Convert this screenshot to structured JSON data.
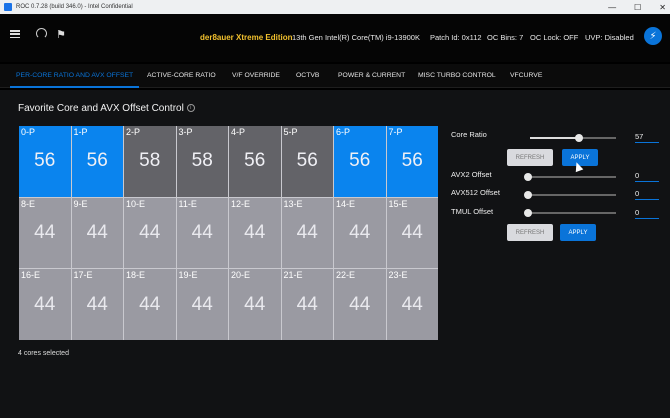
{
  "window": {
    "title": "ROC 0.7.28 (build 346.0) - Intel Confidential",
    "controls": [
      "—",
      "☐",
      "✕"
    ]
  },
  "header": {
    "edition": "der8auer Xtreme Edition",
    "cpu": "13th Gen Intel(R) Core(TM) i9-13900K",
    "patch": "Patch Id: 0x112",
    "oc_bins": "OC Bins: 7",
    "oc_lock": "OC Lock: OFF",
    "uvp": "UVP: Disabled",
    "power_icon": "⚡",
    "flag_icon": "⚑"
  },
  "tabs": [
    {
      "label": "PER-CORE RATIO AND AVX OFFSET",
      "active": true
    },
    {
      "label": "ACTIVE-CORE RATIO"
    },
    {
      "label": "V/F OVERRIDE"
    },
    {
      "label": "OCTVB"
    },
    {
      "label": "POWER & CURRENT"
    },
    {
      "label": "MISC TURBO CONTROL"
    },
    {
      "label": "VFCURVE"
    }
  ],
  "section": {
    "title": "Favorite Core and AVX Offset Control",
    "info_icon": "i"
  },
  "cores": [
    {
      "name": "0-P",
      "value": "56",
      "state": "selected"
    },
    {
      "name": "1-P",
      "value": "56",
      "state": "selected"
    },
    {
      "name": "2-P",
      "value": "58",
      "state": "p-dark"
    },
    {
      "name": "3-P",
      "value": "58",
      "state": "p-dark"
    },
    {
      "name": "4-P",
      "value": "56",
      "state": "p-dark"
    },
    {
      "name": "5-P",
      "value": "56",
      "state": "p-dark"
    },
    {
      "name": "6-P",
      "value": "56",
      "state": "selected"
    },
    {
      "name": "7-P",
      "value": "56",
      "state": "selected"
    },
    {
      "name": "8-E",
      "value": "44",
      "state": "e"
    },
    {
      "name": "9-E",
      "value": "44",
      "state": "e"
    },
    {
      "name": "10-E",
      "value": "44",
      "state": "e"
    },
    {
      "name": "11-E",
      "value": "44",
      "state": "e"
    },
    {
      "name": "12-E",
      "value": "44",
      "state": "e"
    },
    {
      "name": "13-E",
      "value": "44",
      "state": "e"
    },
    {
      "name": "14-E",
      "value": "44",
      "state": "e"
    },
    {
      "name": "15-E",
      "value": "44",
      "state": "e"
    },
    {
      "name": "16-E",
      "value": "44",
      "state": "e"
    },
    {
      "name": "17-E",
      "value": "44",
      "state": "e"
    },
    {
      "name": "18-E",
      "value": "44",
      "state": "e"
    },
    {
      "name": "19-E",
      "value": "44",
      "state": "e"
    },
    {
      "name": "20-E",
      "value": "44",
      "state": "e"
    },
    {
      "name": "21-E",
      "value": "44",
      "state": "e"
    },
    {
      "name": "22-E",
      "value": "44",
      "state": "e"
    },
    {
      "name": "23-E",
      "value": "44",
      "state": "e"
    }
  ],
  "status": "4 cores selected",
  "controls": {
    "core_ratio": {
      "label": "Core Ratio",
      "value": "57",
      "level": 0.57
    },
    "refresh_label": "REFRESH",
    "apply_label": "APPLY",
    "avx2": {
      "label": "AVX2 Offset",
      "value": "0",
      "level": 0
    },
    "avx512": {
      "label": "AVX512 Offset",
      "value": "0",
      "level": 0
    },
    "tmul": {
      "label": "TMUL Offset",
      "value": "0",
      "level": 0
    }
  }
}
